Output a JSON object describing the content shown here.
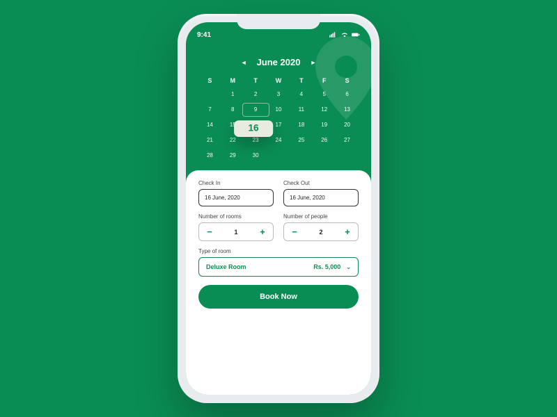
{
  "status": {
    "time": "9:41"
  },
  "calendar": {
    "month_label": "June 2020",
    "dow": [
      "S",
      "M",
      "T",
      "W",
      "T",
      "F",
      "S"
    ],
    "weeks": [
      [
        "",
        "1",
        "2",
        "3",
        "4",
        "5",
        "6"
      ],
      [
        "7",
        "8",
        "9",
        "10",
        "11",
        "12",
        "13"
      ],
      [
        "14",
        "15",
        "16",
        "17",
        "18",
        "19",
        "20"
      ],
      [
        "21",
        "22",
        "23",
        "24",
        "25",
        "26",
        "27"
      ],
      [
        "28",
        "29",
        "30",
        "",
        "",
        "",
        ""
      ]
    ],
    "outlined_day": "9",
    "popped_day": "16"
  },
  "form": {
    "checkin_label": "Check In",
    "checkin_value": "16 June, 2020",
    "checkout_label": "Check Out",
    "checkout_value": "16 June, 2020",
    "rooms_label": "Number of rooms",
    "rooms_value": "1",
    "people_label": "Number of people",
    "people_value": "2",
    "roomtype_label": "Type of room",
    "roomtype_value": "Deluxe Room",
    "roomtype_price": "Rs. 5,000",
    "book_label": "Book Now"
  }
}
